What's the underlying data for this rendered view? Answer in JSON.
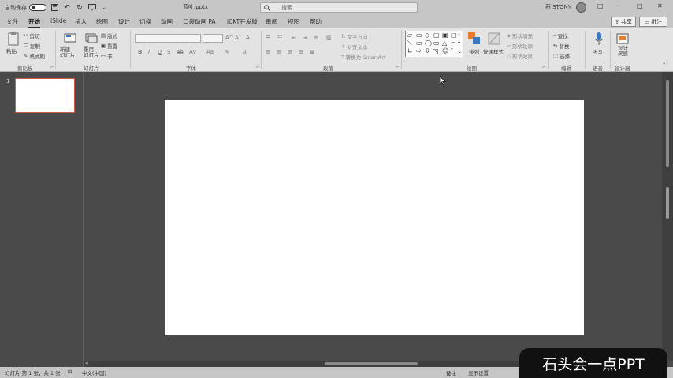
{
  "titlebar": {
    "autosave_label": "自动保存",
    "autosave_state": "关",
    "doc_title": "蓝叶.pptx",
    "search_placeholder": "搜索",
    "user_name": "石 STONY",
    "window_buttons": [
      "□",
      "─",
      "□",
      "✕"
    ]
  },
  "tabs": [
    "文件",
    "开始",
    "iSlide",
    "插入",
    "绘图",
    "设计",
    "切换",
    "动画",
    "口袋动画 PA",
    "iCKT开发版",
    "审阅",
    "视图",
    "帮助"
  ],
  "active_tab": "开始",
  "share_label": "共享",
  "comment_label": "批注",
  "ribbon": {
    "clipboard": {
      "paste": "粘贴",
      "cut": "剪切",
      "copy": "复制",
      "format_painter": "格式刷",
      "label": "剪贴板"
    },
    "slides": {
      "new_slide": "新建\n幻灯片",
      "reuse": "重用\n幻灯片",
      "layout": "版式",
      "reset": "重置",
      "section": "节",
      "label": "幻灯片"
    },
    "font": {
      "label": "字体"
    },
    "paragraph": {
      "text_direction": "文字方向",
      "align_text": "对齐文本",
      "smartart": "转换为 SmartArt",
      "label": "段落"
    },
    "drawing": {
      "arrange": "排列",
      "quick_styles": "快速样式",
      "shape_fill": "形状填充",
      "shape_outline": "形状轮廓",
      "shape_effects": "形状效果",
      "label": "绘图"
    },
    "editing": {
      "find": "查找",
      "replace": "替换",
      "select": "选择",
      "label": "编辑"
    },
    "voice": {
      "dictate": "听写",
      "label": "语音"
    },
    "designer": {
      "design_ideas": "设计\n灵感",
      "label": "设计器"
    }
  },
  "slide_panel": {
    "slide_number": "1"
  },
  "statusbar": {
    "slide_count": "幻灯片 第 1 张，共 1 张",
    "language": "中文(中国)",
    "notes": "备注",
    "display_settings": "显示设置"
  },
  "watermark": "石头会一点PPT",
  "colors": {
    "chrome": "#c6c6c6",
    "ribbon": "#e3e3e3",
    "workspace": "#4a4a4a",
    "slide": "#ffffff",
    "thumb_border": "#d05a4a"
  }
}
